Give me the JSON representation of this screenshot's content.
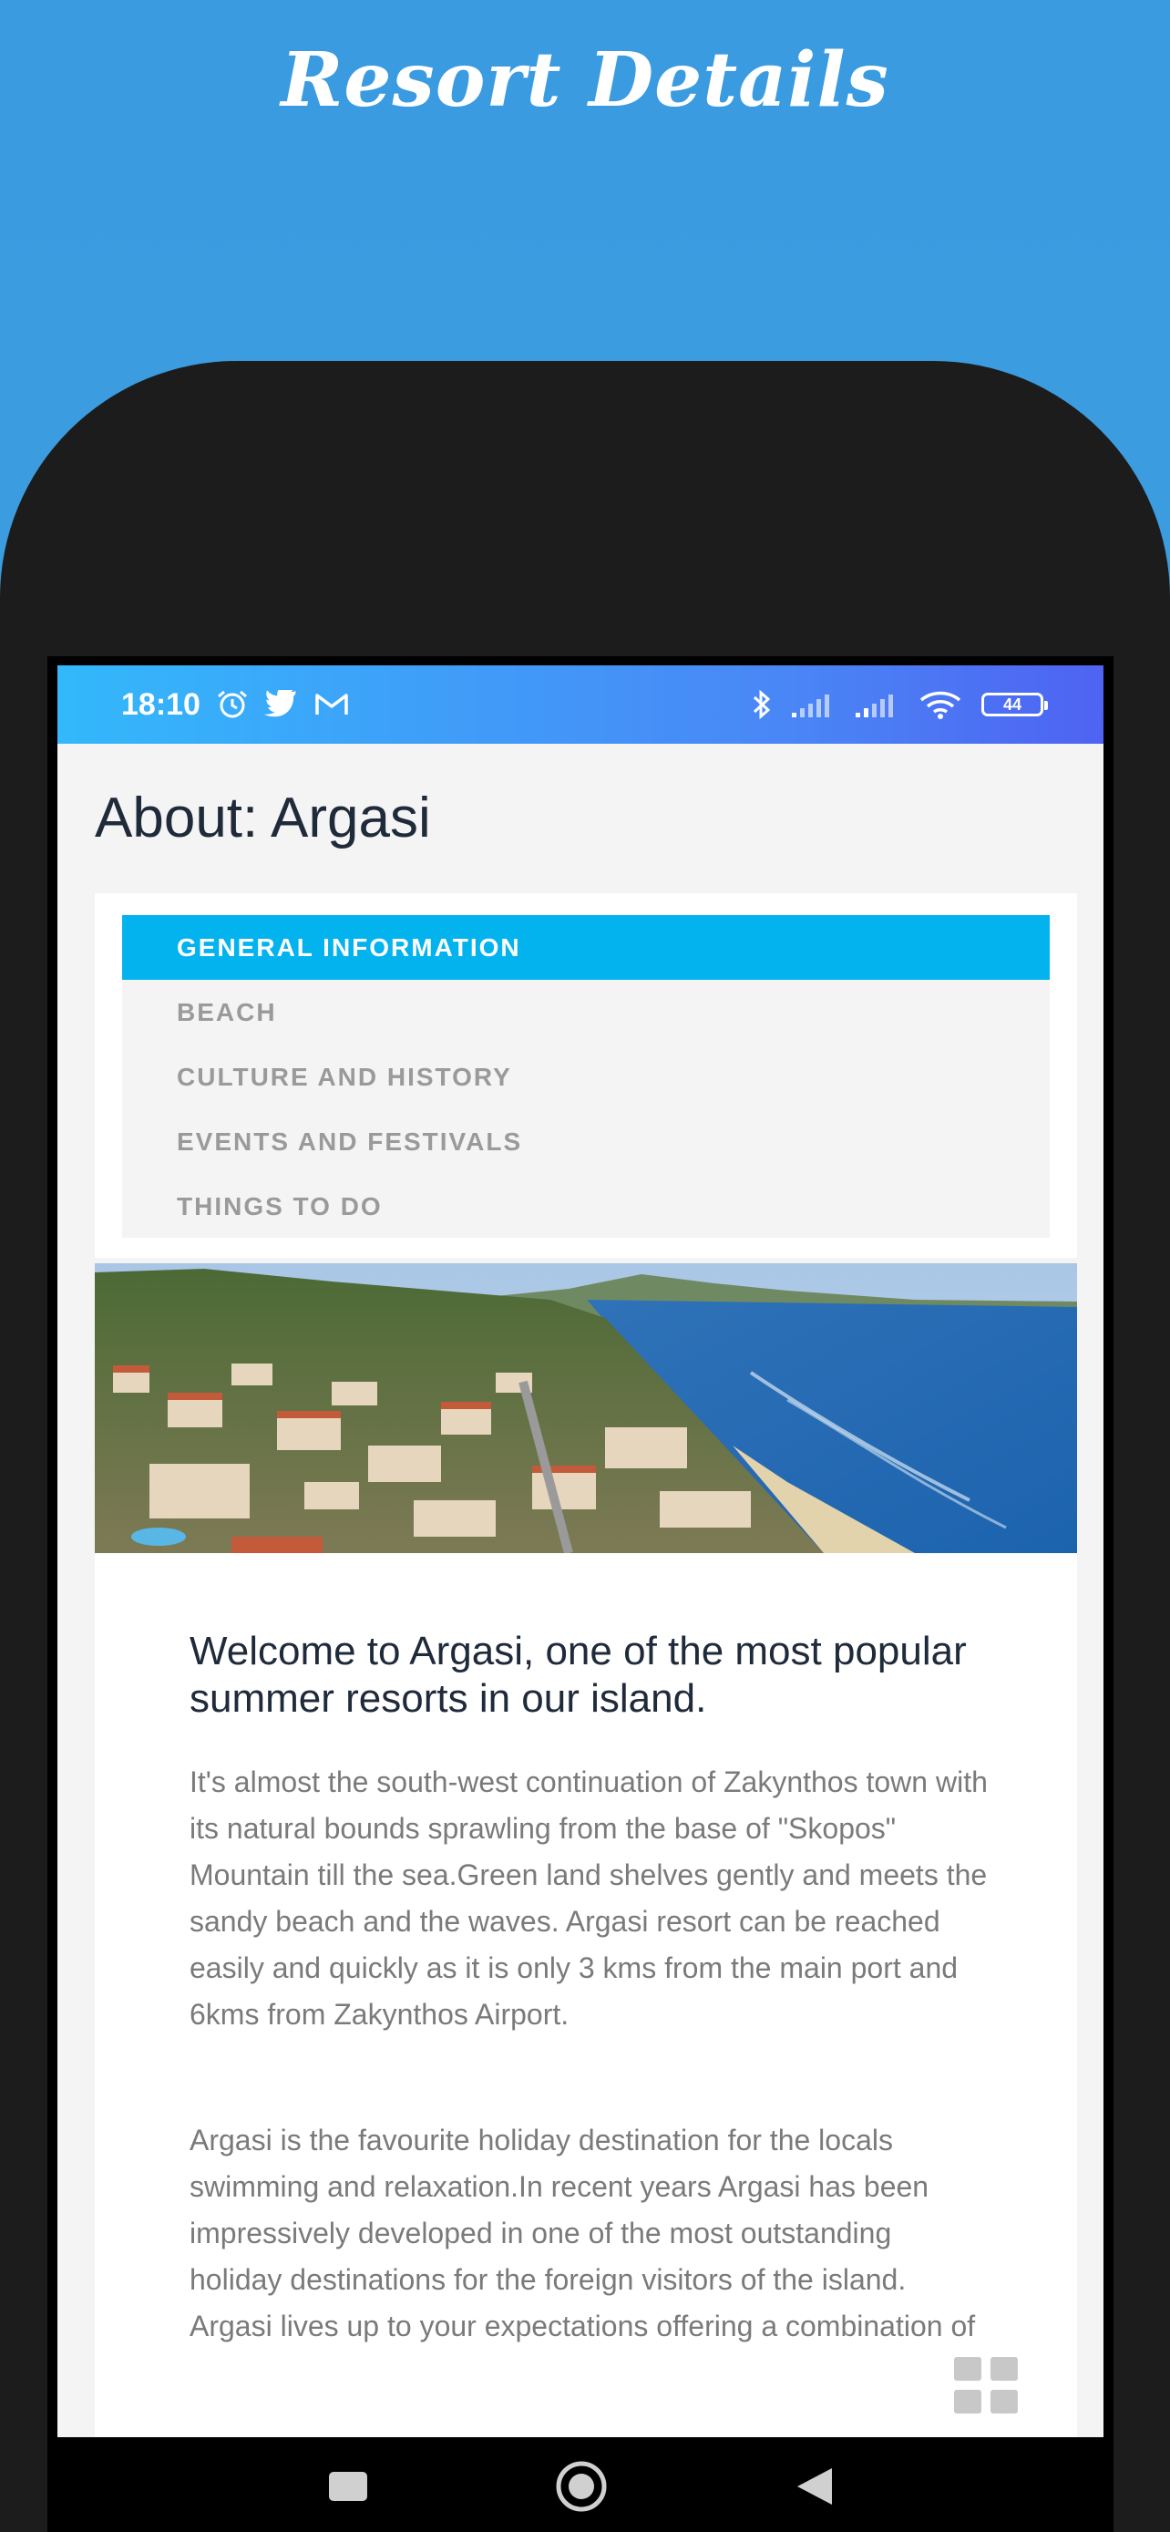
{
  "banner": {
    "title": "Resort Details"
  },
  "status_bar": {
    "time": "18:10",
    "battery": "44",
    "icons_left": [
      "alarm-icon",
      "twitter-icon",
      "gmail-icon"
    ],
    "icons_right": [
      "bluetooth-icon",
      "signal-icon",
      "signal-icon",
      "wifi-icon",
      "battery-icon"
    ]
  },
  "page": {
    "heading": "About: Argasi"
  },
  "tabs": [
    {
      "label": "GENERAL INFORMATION",
      "active": true
    },
    {
      "label": "BEACH",
      "active": false
    },
    {
      "label": "CULTURE AND HISTORY",
      "active": false
    },
    {
      "label": "EVENTS AND FESTIVALS",
      "active": false
    },
    {
      "label": "THINGS TO DO",
      "active": false
    }
  ],
  "content": {
    "welcome": "Welcome to Argasi, one of the most popular summer resorts in our island.",
    "paragraph_1": "It's almost the south-west continuation of Zakynthos town with its natural bounds sprawling from the base of \"Skopos\" Mountain till the sea.Green land shelves gently and meets the sandy beach and the waves. Argasi resort can be reached easily and quickly as it is only 3 kms from the main port and 6kms from Zakynthos Airport.",
    "paragraph_2": "Argasi is the favourite holiday destination for the locals swimming and relaxation.In recent years Argasi has been impressively developed in one of the most outstanding holiday destinations for the foreign visitors of the island. Argasi lives up to your expectations offering a combination of"
  },
  "colors": {
    "accent": "#03b3ee",
    "banner": "#3a9be0",
    "heading_text": "#1f2a3a",
    "body_text": "#7a7a7a"
  },
  "nav_bar": {
    "icons": [
      "square-icon",
      "circle-icon",
      "back-triangle-icon"
    ]
  }
}
